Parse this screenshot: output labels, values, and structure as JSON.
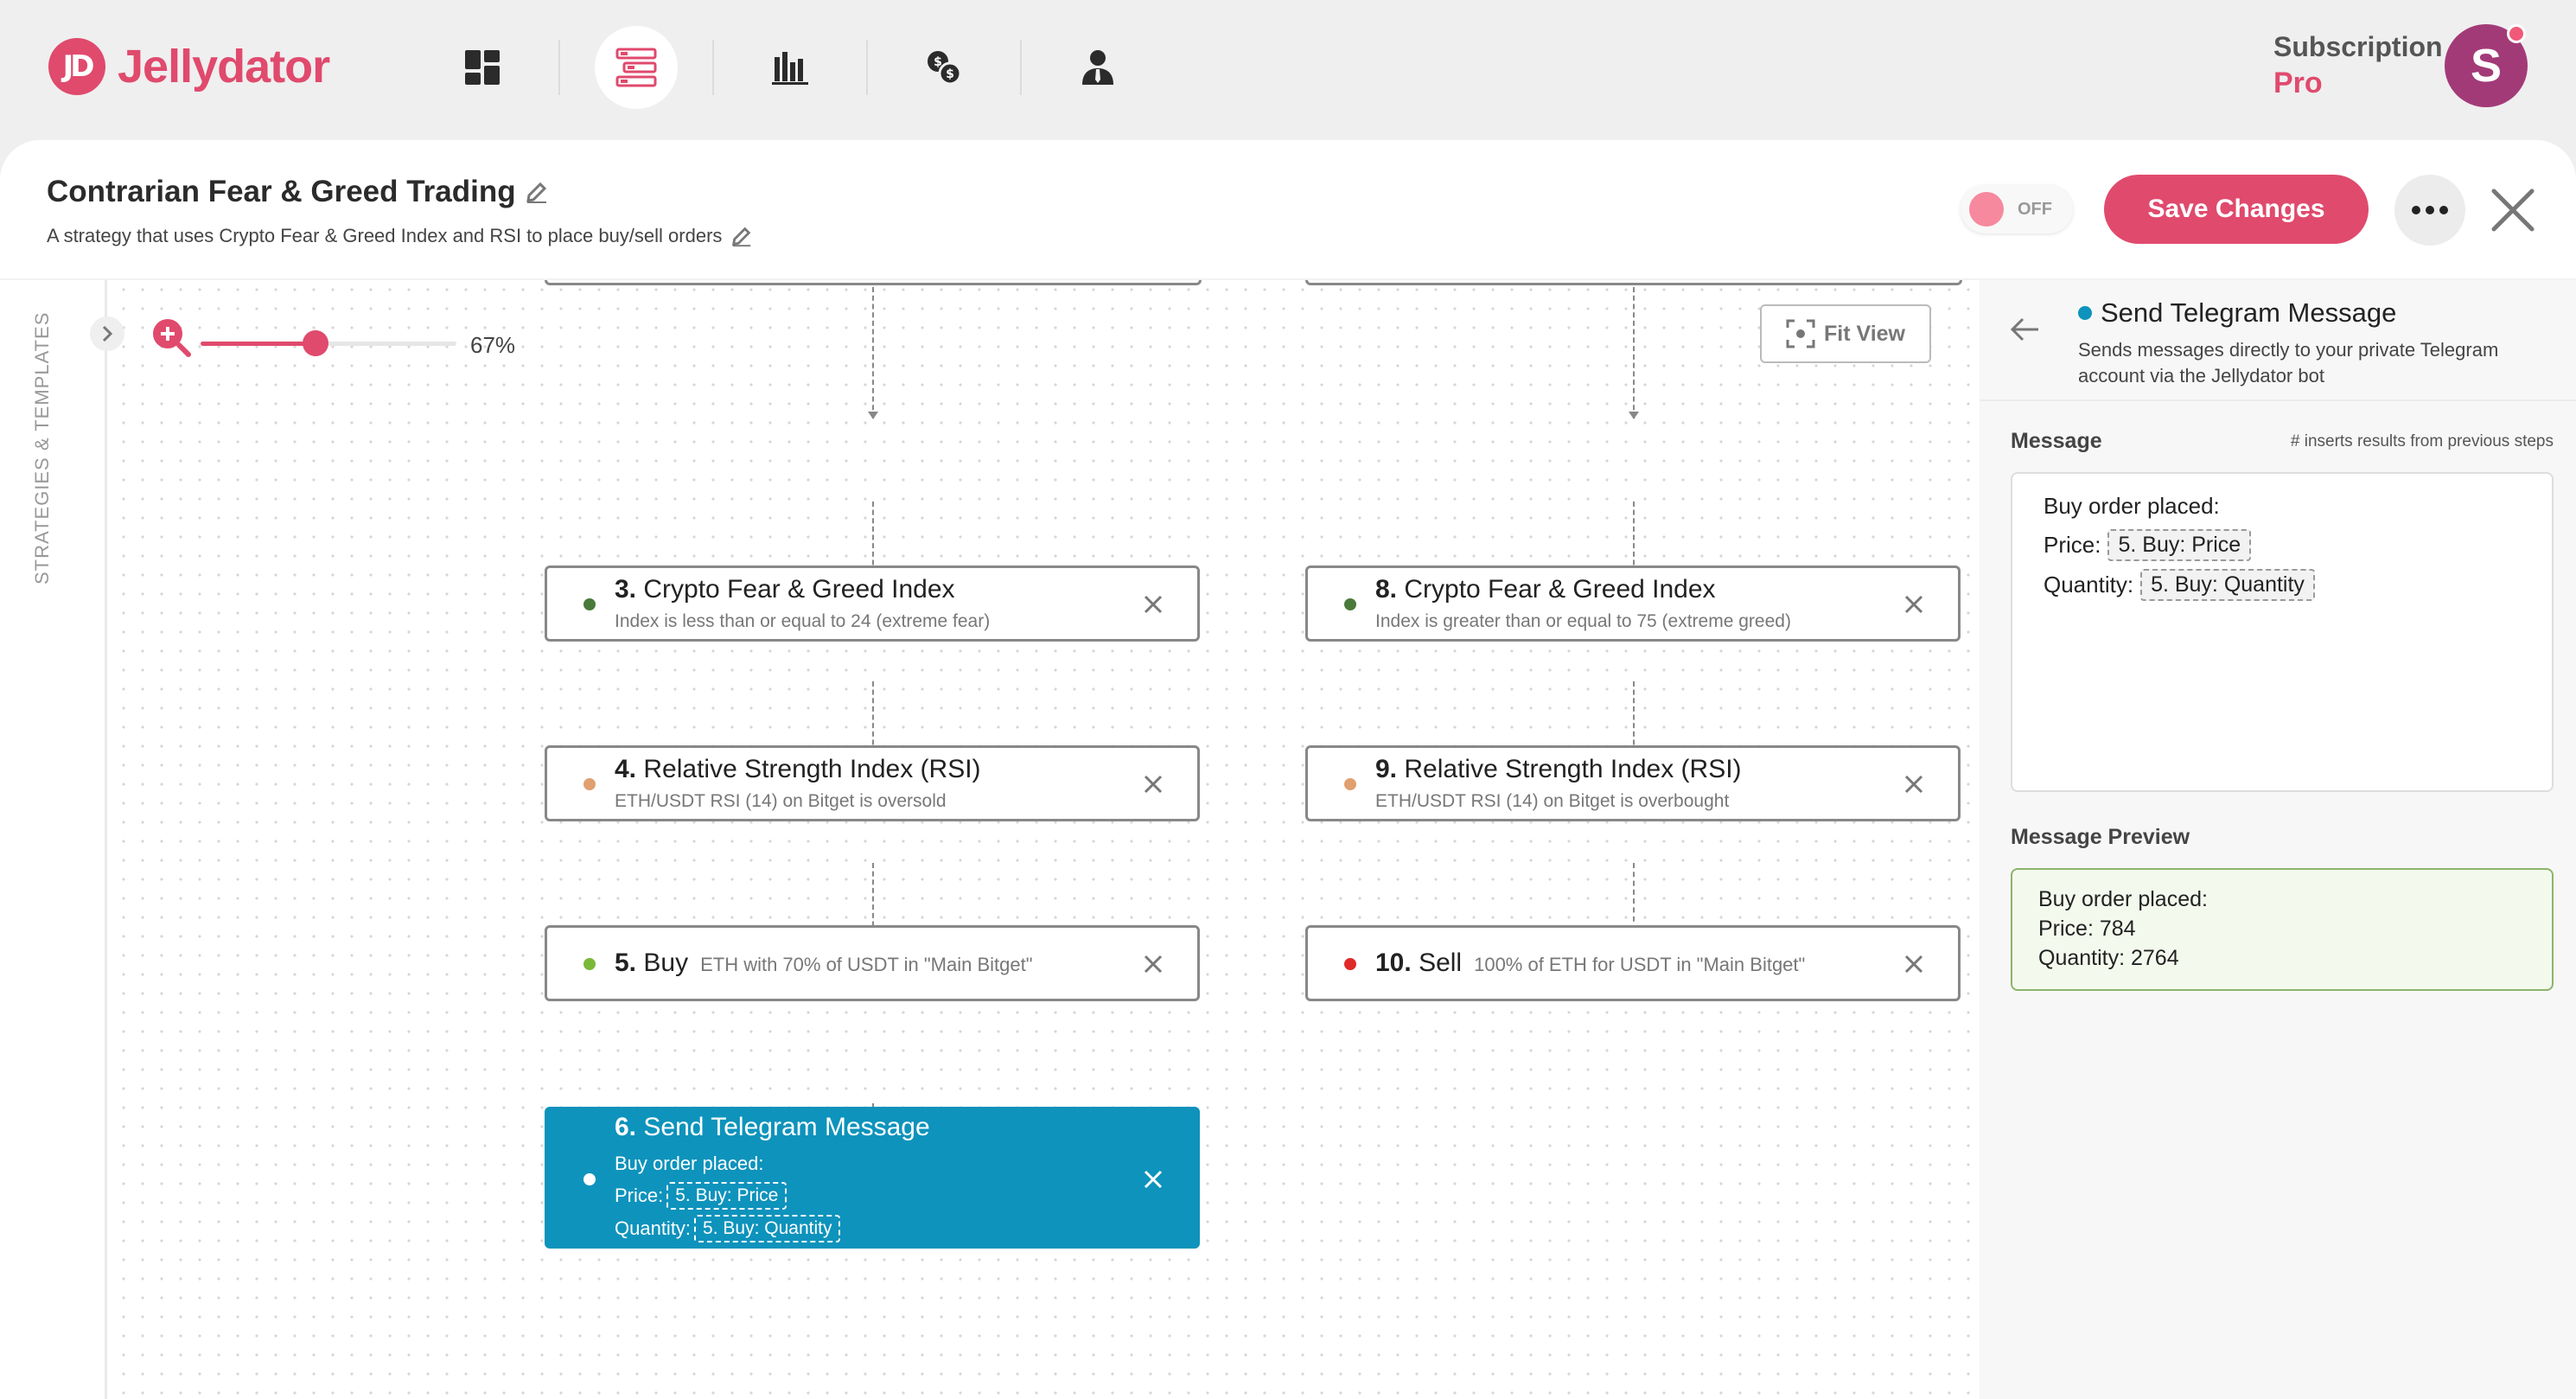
{
  "app": {
    "brand": "Jellydator",
    "logo_mark": "JD",
    "subscription_label": "Subscription",
    "subscription_plan": "Pro",
    "avatar_initial": "S"
  },
  "nav": {
    "items": [
      {
        "name": "dashboard-icon",
        "active": false
      },
      {
        "name": "strategies-icon",
        "active": true
      },
      {
        "name": "analytics-icon",
        "active": false
      },
      {
        "name": "exchange-icon",
        "active": false
      },
      {
        "name": "account-icon",
        "active": false
      }
    ]
  },
  "strategy": {
    "title": "Contrarian Fear & Greed Trading",
    "description": "A strategy that uses Crypto Fear & Greed Index and RSI to place buy/sell orders",
    "toggle_label": "OFF",
    "enabled": false,
    "save_label": "Save Changes"
  },
  "canvas": {
    "side_label": "STRATEGIES & TEMPLATES",
    "zoom_value": "67%",
    "zoom_fraction": 0.45,
    "fit_view_label": "Fit View"
  },
  "nodes": {
    "n3": {
      "num": "3.",
      "title": "Crypto Fear & Greed Index",
      "sub": "Index is less than or equal to 24 (extreme fear)",
      "dot": "#4a7a3a"
    },
    "n4": {
      "num": "4.",
      "title": "Relative Strength Index (RSI)",
      "sub": "ETH/USDT RSI (14) on Bitget is oversold",
      "dot": "#e0a070"
    },
    "n5": {
      "num": "5.",
      "title": "Buy",
      "sub": "ETH with 70% of USDT in \"Main Bitget\"",
      "dot": "#7ab83a"
    },
    "n6": {
      "num": "6.",
      "title": "Send Telegram Message",
      "line1": "Buy order placed:",
      "price_label": "Price:",
      "price_chip": "5. Buy: Price",
      "qty_label": "Quantity:",
      "qty_chip": "5. Buy: Quantity",
      "dot": "#ffffff"
    },
    "n8": {
      "num": "8.",
      "title": "Crypto Fear & Greed Index",
      "sub": "Index is greater than or equal to 75 (extreme greed)",
      "dot": "#4a7a3a"
    },
    "n9": {
      "num": "9.",
      "title": "Relative Strength Index (RSI)",
      "sub": "ETH/USDT RSI (14) on Bitget is overbought",
      "dot": "#e0a070"
    },
    "n10": {
      "num": "10.",
      "title": "Sell",
      "sub": "100% of ETH for USDT in \"Main Bitget\"",
      "dot": "#e02a2a"
    }
  },
  "panel": {
    "title": "Send Telegram Message",
    "description": "Sends messages directly to your private Telegram account via the Jellydator bot",
    "message_label": "Message",
    "message_hint": "# inserts results from previous steps",
    "message_line1": "Buy order placed:",
    "price_label": "Price:",
    "price_chip": "5. Buy: Price",
    "qty_label": "Quantity:",
    "qty_chip": "5. Buy: Quantity",
    "preview_label": "Message Preview",
    "preview_line1": "Buy order placed:",
    "preview_line2": "Price: 784",
    "preview_line3": "Quantity: 2764"
  },
  "colors": {
    "brand": "#e04a6d",
    "selected_node": "#0e93bc",
    "preview_border": "#8bb56a"
  }
}
